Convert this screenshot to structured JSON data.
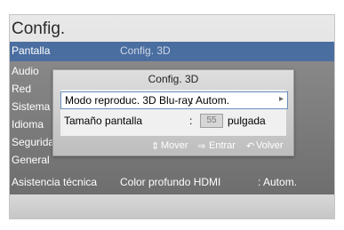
{
  "window": {
    "title": "Config."
  },
  "header": {
    "category": "Pantalla",
    "subtitle": "Config. 3D"
  },
  "sidebar": {
    "items": [
      {
        "label": "Audio"
      },
      {
        "label": "Red"
      },
      {
        "label": "Sistema"
      },
      {
        "label": "Idioma"
      },
      {
        "label": "Seguridad"
      },
      {
        "label": "General"
      },
      {
        "label": "Asistencia técnica"
      }
    ]
  },
  "main_row": {
    "label": "Color profundo HDMI",
    "value": ": Autom."
  },
  "popup": {
    "title": "Config. 3D",
    "rows": [
      {
        "label": "Modo reproduc. 3D Blu-ray",
        "value": ": Autom.",
        "arrow_icon": "chevron-right-icon"
      },
      {
        "label": "Tamaño pantalla",
        "colon": ":",
        "value": "55",
        "unit": "pulgada"
      }
    ],
    "footer": {
      "move": "Mover",
      "move_icon": "up-down-arrow-icon",
      "enter": "Entrar",
      "enter_icon": "enter-icon",
      "back": "Volver",
      "back_icon": "return-icon"
    }
  },
  "colors": {
    "selected_bar": "#4a6ea0",
    "menu_bg": "#7e7e7e"
  }
}
